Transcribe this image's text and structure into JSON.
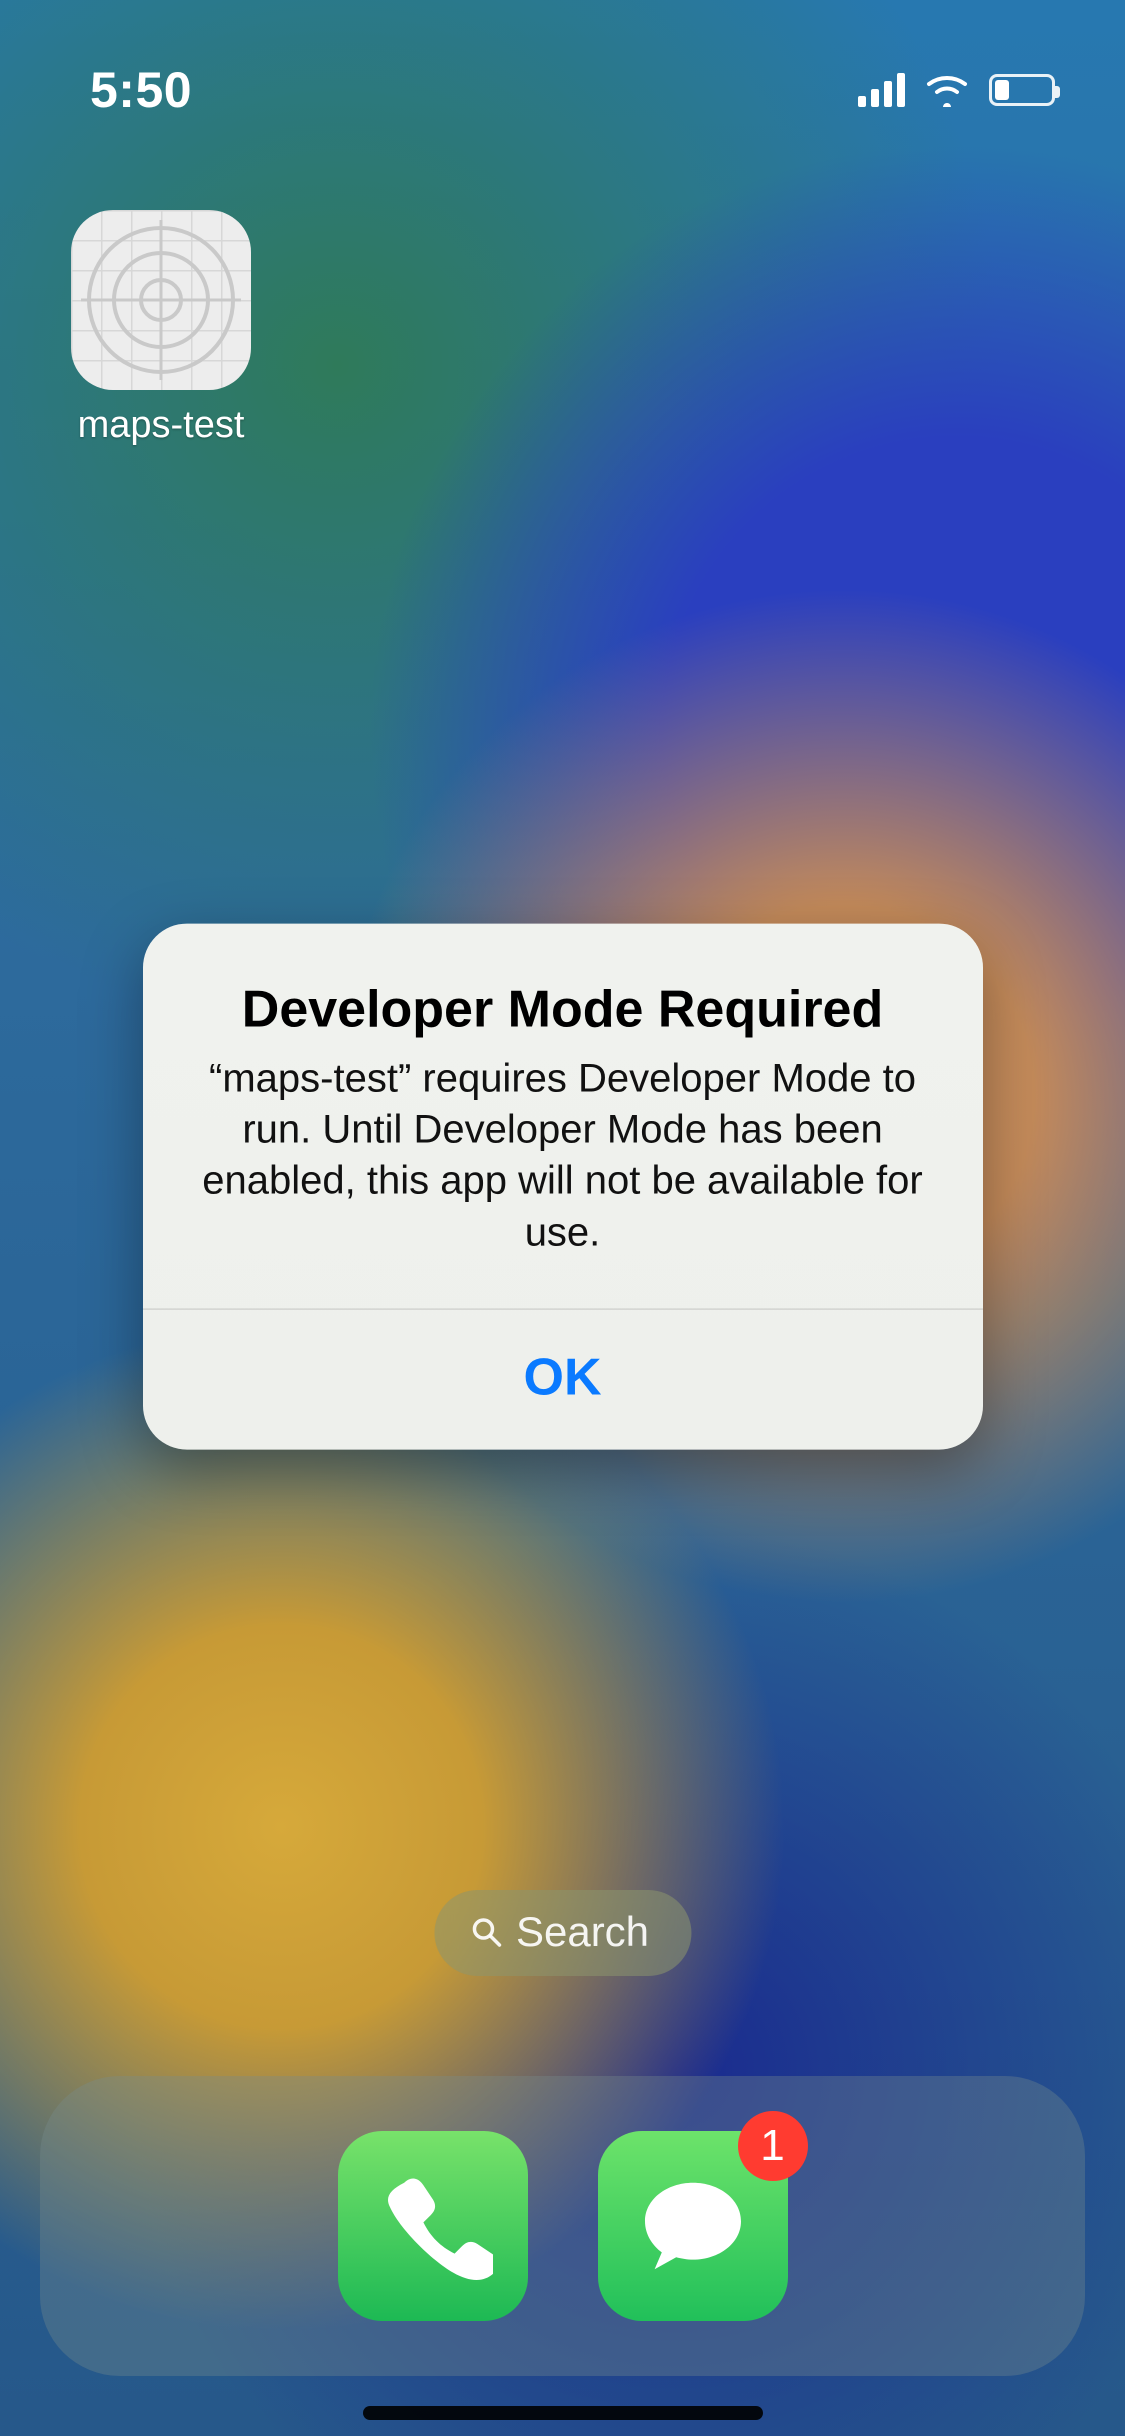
{
  "status_bar": {
    "time": "5:50"
  },
  "home": {
    "apps": [
      {
        "label": "maps-test",
        "icon": "placeholder-target-icon"
      }
    ]
  },
  "alert": {
    "title": "Developer Mode Required",
    "message": "“maps-test” requires Developer Mode to run. Until Developer Mode has been enabled, this app will not be available for use.",
    "ok_label": "OK"
  },
  "search": {
    "label": "Search"
  },
  "dock": {
    "apps": [
      {
        "name": "phone",
        "badge": null
      },
      {
        "name": "messages",
        "badge": "1"
      }
    ]
  },
  "colors": {
    "alert_button": "#0a7aff",
    "badge": "#ff3b30"
  }
}
